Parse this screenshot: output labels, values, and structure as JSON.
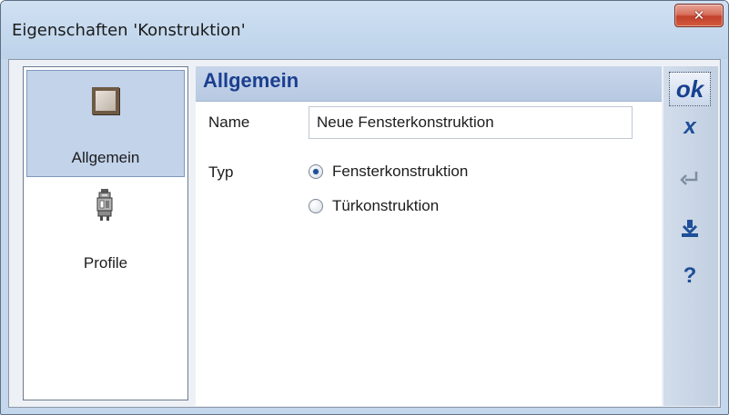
{
  "window": {
    "title": "Eigenschaften 'Konstruktion'",
    "close_glyph": "✕"
  },
  "nav": {
    "items": [
      {
        "label": "Allgemein",
        "icon": "window-frame-icon",
        "selected": true
      },
      {
        "label": "Profile",
        "icon": "profile-section-icon",
        "selected": false
      }
    ]
  },
  "section": {
    "title": "Allgemein"
  },
  "form": {
    "name_label": "Name",
    "name_value": "Neue Fensterkonstruktion",
    "typ_label": "Typ",
    "typ_options": [
      {
        "label": "Fensterkonstruktion",
        "checked": true
      },
      {
        "label": "Türkonstruktion",
        "checked": false
      }
    ]
  },
  "toolbar": {
    "ok_label": "ok",
    "cancel_glyph": "x",
    "help_glyph": "?",
    "buttons": [
      "ok-button",
      "cancel-button",
      "enter-icon",
      "anchor-icon",
      "help-button"
    ]
  },
  "colors": {
    "accent": "#1f4f98",
    "header_text": "#1b3f8f",
    "nav_selected": "#c2d3ea",
    "close_button": "#c2412b"
  }
}
